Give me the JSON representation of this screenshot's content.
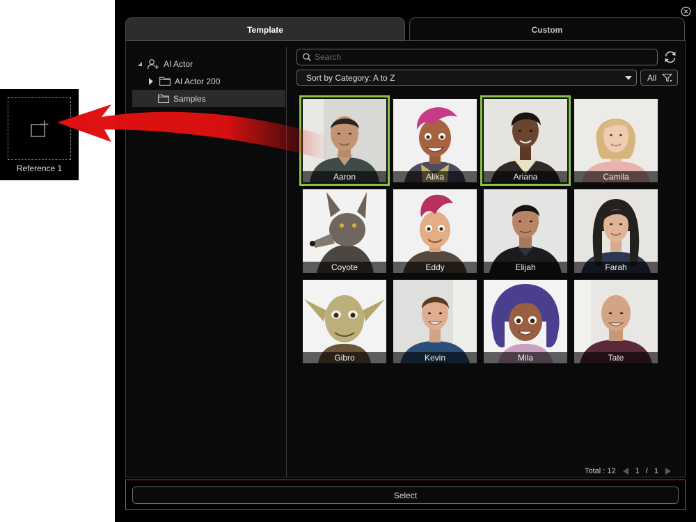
{
  "reference": {
    "label": "Reference 1",
    "icon": "add-media-icon"
  },
  "dialog": {
    "tabs": [
      {
        "label": "Template",
        "active": true
      },
      {
        "label": "Custom",
        "active": false
      }
    ],
    "tree": [
      {
        "label": "AI Actor",
        "icon": "add-person-icon",
        "expanded": true
      },
      {
        "label": "AI Actor 200",
        "icon": "folder-icon",
        "expanded": false
      },
      {
        "label": "Samples",
        "icon": "folder-icon",
        "selected": true
      }
    ],
    "search": {
      "placeholder": "Search",
      "value": ""
    },
    "sort": {
      "value": "Sort by Category: A to Z"
    },
    "filter": {
      "label": "All"
    },
    "items": [
      {
        "name": "Aaron",
        "selected": true
      },
      {
        "name": "Alika",
        "selected": false
      },
      {
        "name": "Ariana",
        "selected": true
      },
      {
        "name": "Camila",
        "selected": false
      },
      {
        "name": "Coyote",
        "selected": false
      },
      {
        "name": "Eddy",
        "selected": false
      },
      {
        "name": "Elijah",
        "selected": false
      },
      {
        "name": "Farah",
        "selected": false
      },
      {
        "name": "Gibro",
        "selected": false
      },
      {
        "name": "Kevin",
        "selected": false
      },
      {
        "name": "Mila",
        "selected": false
      },
      {
        "name": "Tate",
        "selected": false
      }
    ],
    "pager": {
      "total_label": "Total : 12",
      "current": "1",
      "separator": "/",
      "pages": "1"
    },
    "select_label": "Select"
  },
  "colors": {
    "selection": "#8bc34a",
    "arrow": "#e01010",
    "frame": "#e53935",
    "background": "#000000"
  }
}
